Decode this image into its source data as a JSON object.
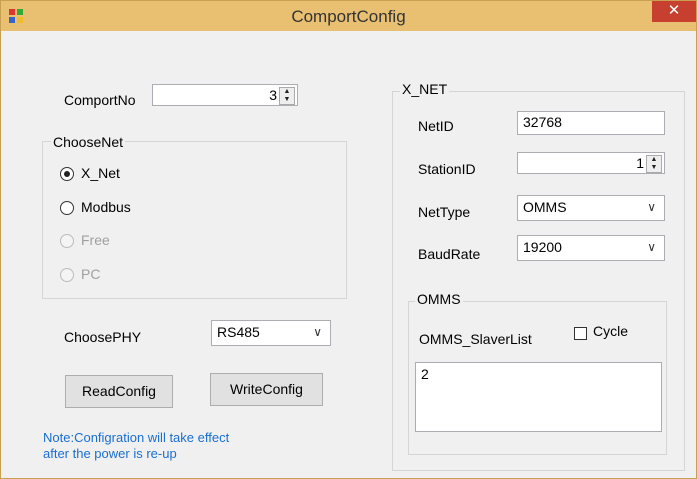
{
  "window": {
    "title": "ComportConfig",
    "close_glyph": "✕"
  },
  "comport": {
    "label": "ComportNo",
    "value": "3"
  },
  "choose_net": {
    "title": "ChooseNet",
    "options": [
      {
        "label": "X_Net",
        "selected": true,
        "enabled": true
      },
      {
        "label": "Modbus",
        "selected": false,
        "enabled": true
      },
      {
        "label": "Free",
        "selected": false,
        "enabled": false
      },
      {
        "label": "PC",
        "selected": false,
        "enabled": false
      }
    ]
  },
  "phy": {
    "label": "ChoosePHY",
    "value": "RS485"
  },
  "buttons": {
    "read": "ReadConfig",
    "write": "WriteConfig"
  },
  "note": {
    "line1": "Note:Configration will take effect",
    "line2": "after the power is re-up"
  },
  "xnet": {
    "title": "X_NET",
    "netid_label": "NetID",
    "netid_value": "32768",
    "stationid_label": "StationID",
    "stationid_value": "1",
    "nettype_label": "NetType",
    "nettype_value": "OMMS",
    "baudrate_label": "BaudRate",
    "baudrate_value": "19200"
  },
  "omms": {
    "title": "OMMS",
    "slaverlist_label": "OMMS_SlaverList",
    "cycle_label": "Cycle",
    "list_items": [
      "2"
    ]
  },
  "colors": {
    "titlebar": "#e9c072",
    "close": "#c7402f",
    "note": "#1a6fd0"
  }
}
